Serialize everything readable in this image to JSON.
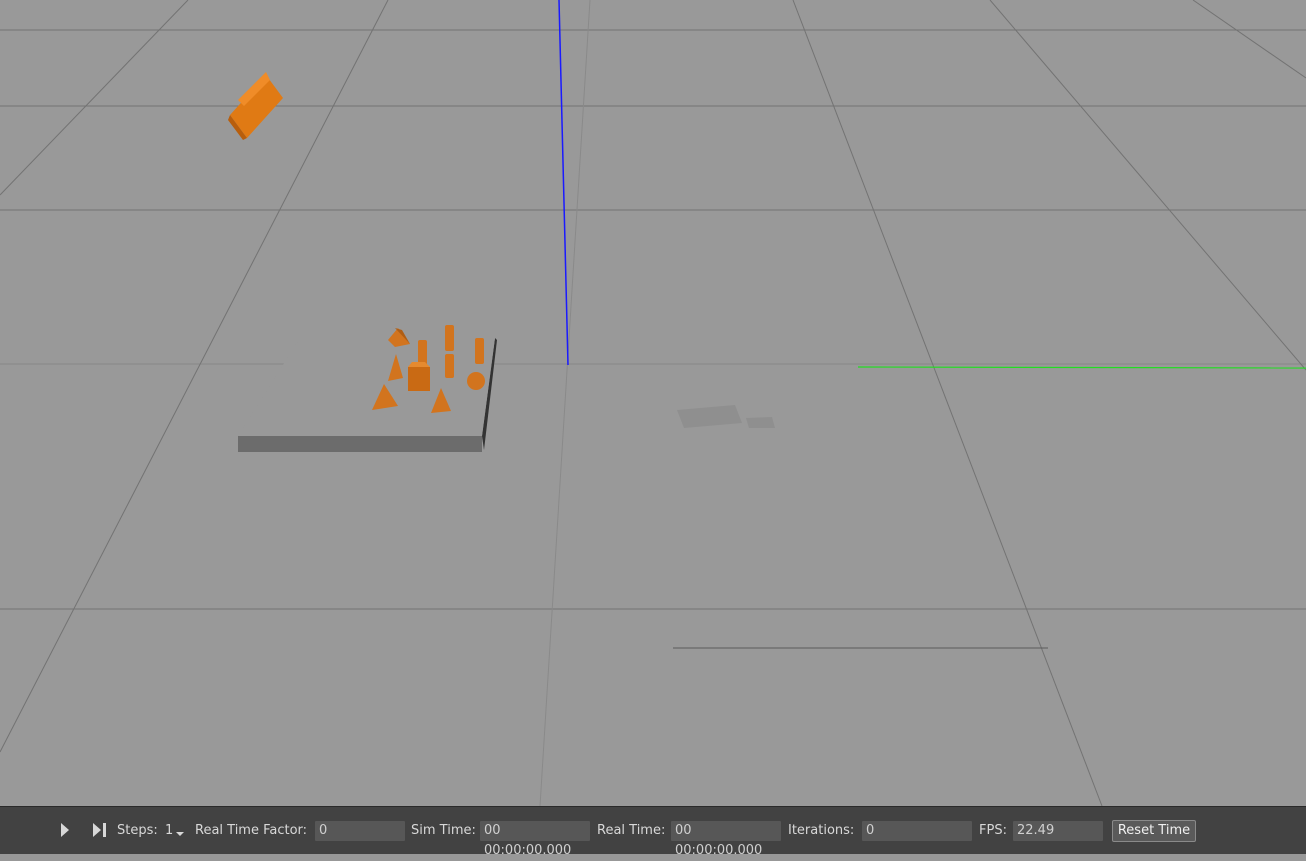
{
  "toolbar": {
    "play_icon": "play-icon",
    "step_icon": "step-icon",
    "steps_label": "Steps:",
    "steps_value": "1",
    "real_time_factor_label": "Real Time Factor:",
    "real_time_factor_value": "0",
    "sim_time_label": "Sim Time:",
    "sim_time_value": "00 00:00:00.000",
    "real_time_label": "Real Time:",
    "real_time_value": "00 00:00:00.000",
    "iterations_label": "Iterations:",
    "iterations_value": "0",
    "fps_label": "FPS:",
    "fps_value": "22.49",
    "reset_time_label": "Reset Time"
  },
  "scene": {
    "ground_color": "#999999",
    "grid_color": "#6e6e6e",
    "object_color": "#d2741e",
    "axis_z_color": "#1a1aff",
    "axis_y_color": "#22dd22"
  }
}
